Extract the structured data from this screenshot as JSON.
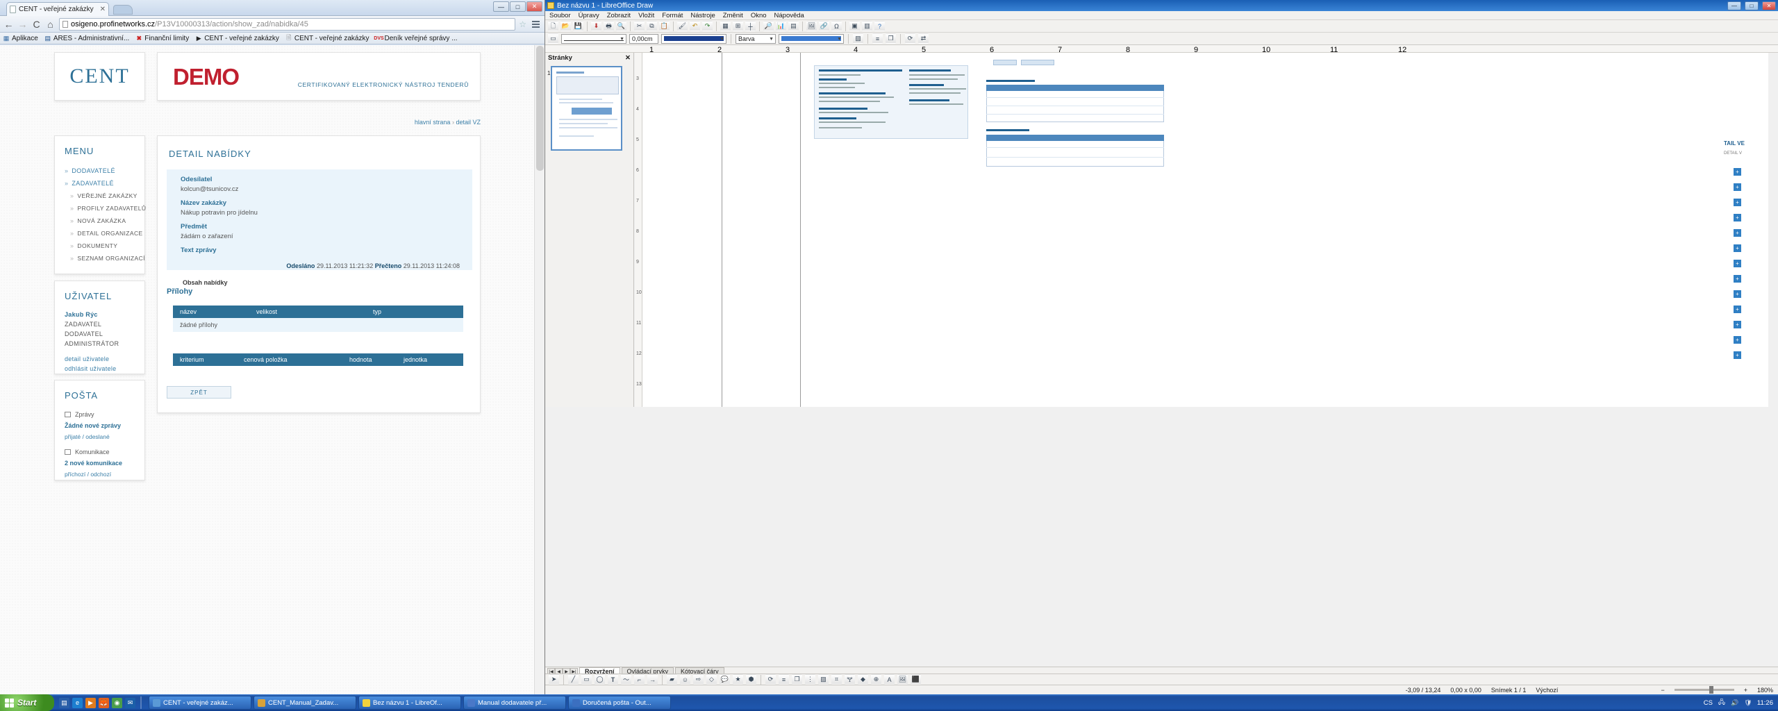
{
  "browser": {
    "tab_title": "CENT - veřejné zakázky",
    "tab_close": "✕",
    "url_host": "osigeno.profinetworks.cz",
    "url_path": "/P13V10000313/action/show_zad/nabidka/45",
    "back_icon": "←",
    "forward_icon": "→",
    "reload_icon": "C",
    "home_icon": "⌂",
    "star_icon": "☆",
    "minimize": "—",
    "maximize": "□",
    "close": "✕",
    "bookmarks": [
      {
        "label": "Aplikace",
        "icon": "grid-icon"
      },
      {
        "label": "ARES - Administrativní...",
        "icon": "ares-icon"
      },
      {
        "label": "Finanční limity",
        "icon": "red-x-icon"
      },
      {
        "label": "CENT - veřejné zakázky",
        "icon": "play-icon"
      },
      {
        "label": "CENT - veřejné zakázky",
        "icon": "page-icon"
      },
      {
        "label": "Deník veřejné správy ...",
        "icon": "dvs-icon"
      }
    ]
  },
  "site": {
    "logo": "CENT",
    "demo_badge": "DEMO",
    "certified_line": "CERTIFIKOVANÝ ELEKTRONICKÝ NÁSTROJ TENDERŮ",
    "breadcrumb": {
      "home": "hlavní strana",
      "sep": "›",
      "current": "detail VZ"
    }
  },
  "sidebar": {
    "menu_heading": "MENU",
    "menu_items": [
      {
        "label": "DODAVATELÉ",
        "level": 0
      },
      {
        "label": "ZADAVATELÉ",
        "level": 0
      },
      {
        "label": "VEŘEJNÉ ZAKÁZKY",
        "level": 1
      },
      {
        "label": "PROFILY ZADAVATELŮ",
        "level": 1
      },
      {
        "label": "NOVÁ ZAKÁZKA",
        "level": 1
      },
      {
        "label": "DETAIL ORGANIZACE",
        "level": 1
      },
      {
        "label": "DOKUMENTY",
        "level": 1
      },
      {
        "label": "SEZNAM ORGANIZACÍ",
        "level": 1
      }
    ],
    "user_heading": "UŽIVATEL",
    "user_name": "Jakub Rýc",
    "user_roles": [
      "ZADAVATEL",
      "DODAVATEL",
      "ADMINISTRÁTOR"
    ],
    "user_links": [
      "detail uživatele",
      "odhlásit uživatele"
    ],
    "post_heading": "POŠTA",
    "post_messages_label": "Zprávy",
    "post_no_new": "Žádné nové zprávy",
    "post_sublink": "přijaté / odeslané",
    "post_comm_label": "Komunikace",
    "post_new_comm": "2 nové komunikace",
    "post_comm_sub": "příchozí / odchozí"
  },
  "main": {
    "title": "DETAIL NABÍDKY",
    "fields": [
      {
        "label": "Odesílatel",
        "value": "kolcun@tsunicov.cz"
      },
      {
        "label": "Název zakázky",
        "value": "Nákup potravin pro jídelnu"
      },
      {
        "label": "Předmět",
        "value": "žádám o zařazení"
      },
      {
        "label": "Text zprávy",
        "value": ""
      }
    ],
    "sent_label": "Odesláno",
    "sent_value": "29.11.2013 11:21:32",
    "read_label": "Přečteno",
    "read_value": "29.11.2013 11:24:08",
    "content_label": "Obsah nabídky",
    "attachments_title": "Přílohy",
    "attachments_columns": [
      "název",
      "velikost",
      "typ"
    ],
    "attachments_empty": "žádné přílohy",
    "criteria_columns": [
      "kriterium",
      "cenová položka",
      "hodnota",
      "jednotka"
    ],
    "back_button": "ZPĚT"
  },
  "libreoffice": {
    "window_title": "Bez názvu 1 - LibreOffice Draw",
    "minimize": "—",
    "maximize": "□",
    "close": "✕",
    "menus": [
      "Soubor",
      "Úpravy",
      "Zobrazit",
      "Vložit",
      "Formát",
      "Nástroje",
      "Změnit",
      "Okno",
      "Nápověda"
    ],
    "line_width_value": "0,00cm",
    "fill_style_value": "Barva",
    "pane_title": "Stránky",
    "pane_close": "✕",
    "page_number": "1",
    "tabs": [
      "Rozvržení",
      "Ovládací prvky",
      "Kótovací čáry"
    ],
    "active_tab": "Rozvržení",
    "status_position": "-3,09 / 13,24",
    "status_size": "0,00 x 0,00",
    "status_slide": "Snímek 1 / 1",
    "status_layout": "Výchozí",
    "zoom_level": "180%",
    "ruler_marks": [
      "1",
      "2",
      "3",
      "4",
      "5",
      "6",
      "7",
      "8",
      "9",
      "10",
      "11",
      "12"
    ],
    "vruler_marks": [
      "3",
      "4",
      "5",
      "6",
      "7",
      "8",
      "9",
      "10",
      "11",
      "12",
      "13"
    ]
  },
  "taskbar": {
    "start_label": "Start",
    "buttons": [
      {
        "label": "CENT - veřejné zakáz...",
        "color": "#5a9ad6"
      },
      {
        "label": "CENT_Manual_Zadav...",
        "color": "#d8a23a"
      },
      {
        "label": "Bez názvu 1 - LibreOf...",
        "color": "#f2d23c"
      },
      {
        "label": "Manual dodavatele př...",
        "color": "#4a78c8"
      },
      {
        "label": "Doručená pošta - Out...",
        "color": "#3b6fc0"
      }
    ],
    "lang": "CS",
    "time": "11:26",
    "tray_icons": [
      "network-icon",
      "volume-icon",
      "shield-icon"
    ]
  }
}
